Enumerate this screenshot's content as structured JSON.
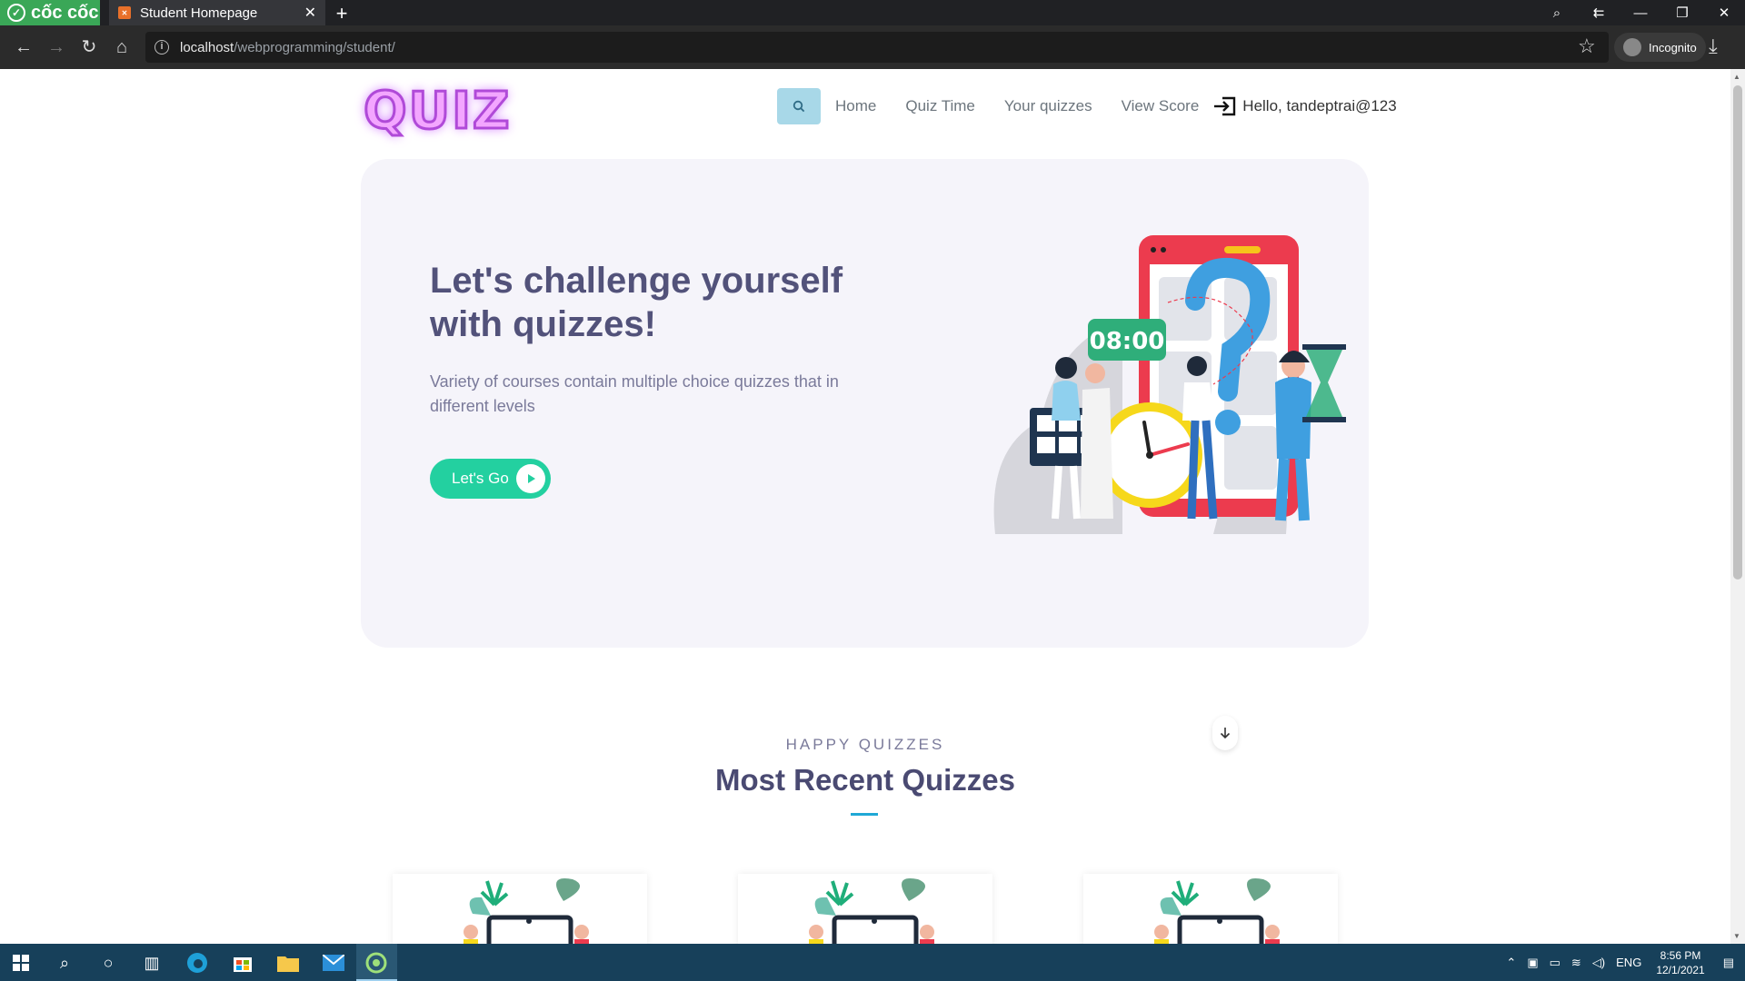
{
  "browser": {
    "brand": "cốc cốc",
    "tab_title": "Student Homepage",
    "url_host": "localhost",
    "url_path": "/webprogramming/student/",
    "incognito_label": "Incognito"
  },
  "site": {
    "logo": "QUIZ",
    "nav": {
      "home": "Home",
      "quiz_time": "Quiz Time",
      "your_quizzes": "Your quizzes",
      "view_score": "View Score",
      "greeting": "Hello, tandeptrai@123"
    },
    "hero": {
      "title": "Let's challenge yourself with quizzes!",
      "description": "Variety of courses contain multiple choice quizzes that in different levels",
      "button": "Let's Go",
      "clock_text": "08:00"
    },
    "section": {
      "kicker": "HAPPY QUIZZES",
      "title": "Most Recent Quizzes"
    }
  },
  "taskbar": {
    "language": "ENG",
    "time": "8:56 PM",
    "date": "12/1/2021"
  },
  "colors": {
    "accent_green": "#23d0a0",
    "hero_bg": "#f5f4fa",
    "heading": "#52527a",
    "logo": "#b04ad8",
    "section_bar": "#1fa8d6",
    "taskbar": "#17405a"
  }
}
